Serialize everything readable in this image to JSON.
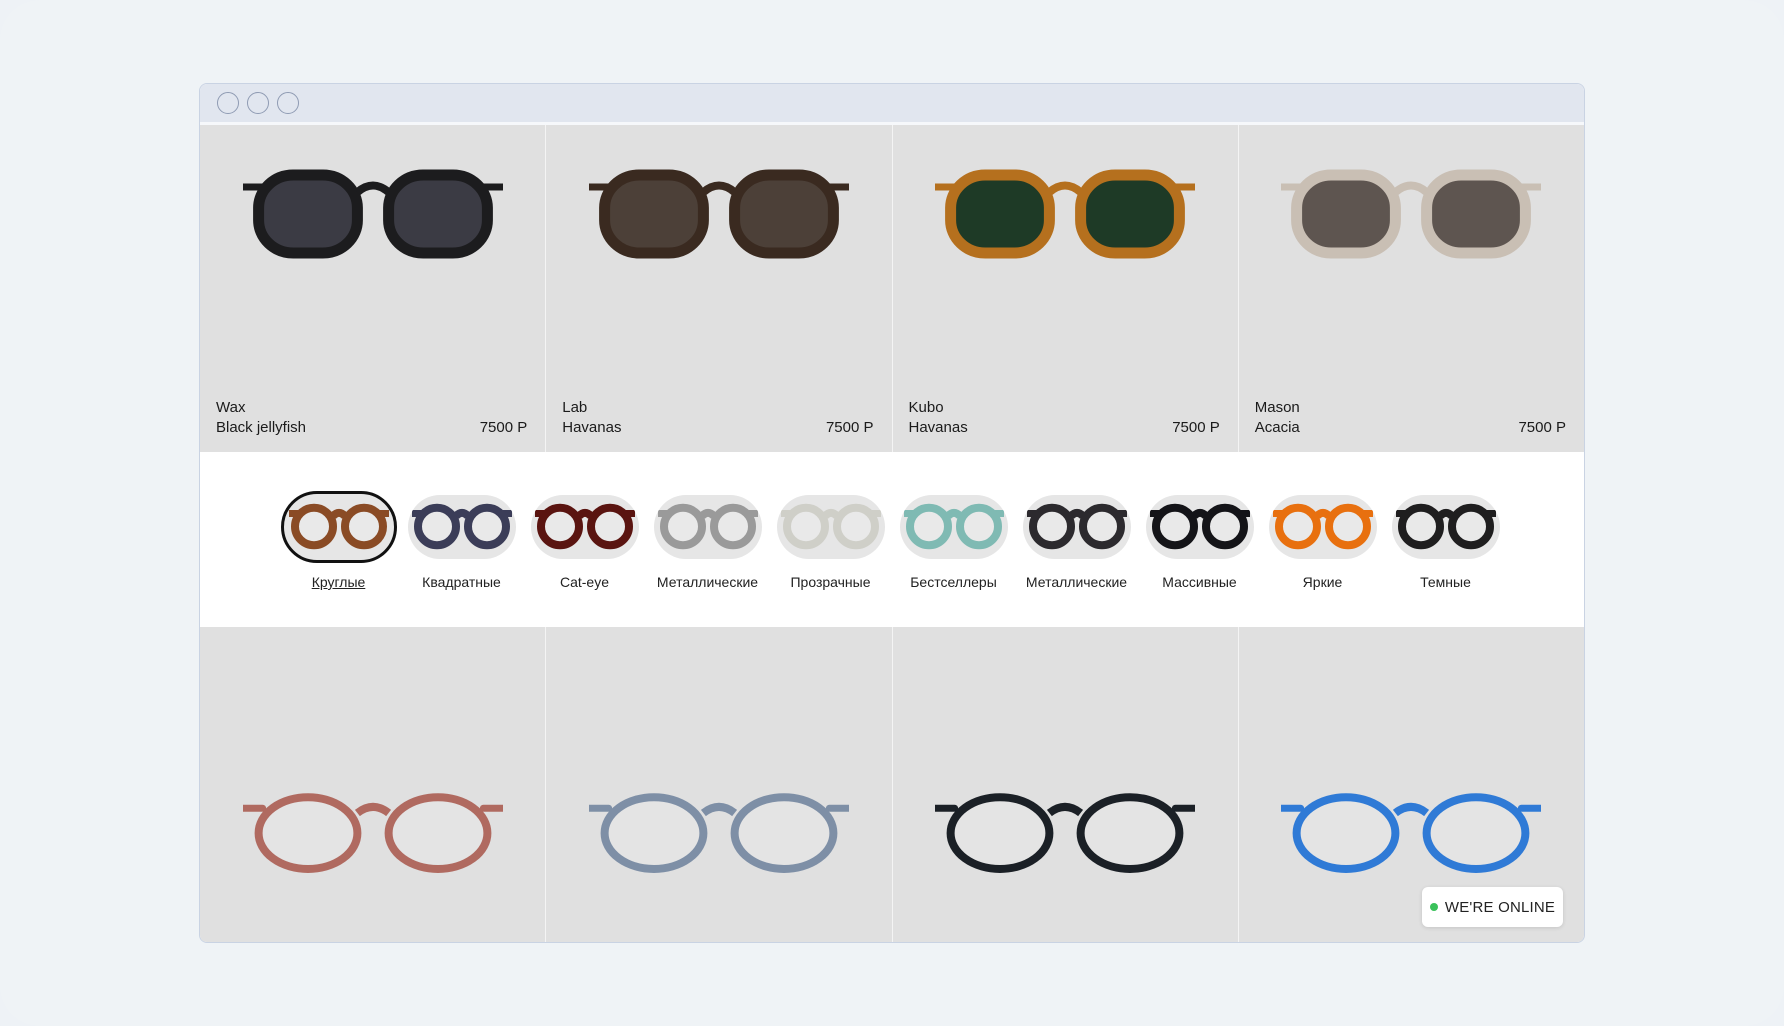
{
  "window": {
    "controls": [
      "window-dot",
      "window-dot",
      "window-dot"
    ]
  },
  "top_products": [
    {
      "model": "Wax",
      "color": "Black jellyfish",
      "price": "7500 Р",
      "frame": "#1c1c1e",
      "lens": "#3b3b44"
    },
    {
      "model": "Lab",
      "color": "Havanas",
      "price": "7500 Р",
      "frame": "#3a2a20",
      "lens": "#4c4038"
    },
    {
      "model": "Kubo",
      "color": "Havanas",
      "price": "7500 Р",
      "frame": "#b5701e",
      "lens": "#1e3a26"
    },
    {
      "model": "Mason",
      "color": "Acacia",
      "price": "7500 Р",
      "frame": "#c9bfb4",
      "lens": "#5e5550"
    }
  ],
  "categories": [
    {
      "label": "Круглые",
      "active": true,
      "frame": "#8a4b25"
    },
    {
      "label": "Квадратные",
      "active": false,
      "frame": "#3b3d58"
    },
    {
      "label": "Cat-eye",
      "active": false,
      "frame": "#5a1410"
    },
    {
      "label": "Металлические",
      "active": false,
      "frame": "#9a9a9a"
    },
    {
      "label": "Прозрачные",
      "active": false,
      "frame": "#cfcfc8"
    },
    {
      "label": "Бестселлеры",
      "active": false,
      "frame": "#7fbab3"
    },
    {
      "label": "Металлические",
      "active": false,
      "frame": "#2c2a2e"
    },
    {
      "label": "Массивные",
      "active": false,
      "frame": "#141418"
    },
    {
      "label": "Яркие",
      "active": false,
      "frame": "#e8700f"
    },
    {
      "label": "Темные",
      "active": false,
      "frame": "#1f1e1f"
    }
  ],
  "bottom_products": [
    {
      "frame": "#b06a60"
    },
    {
      "frame": "#7e8fa6"
    },
    {
      "frame": "#1b2026"
    },
    {
      "frame": "#2f7ad6"
    }
  ],
  "chat": {
    "label": "WE'RE ONLINE",
    "status_color": "#3ac15a"
  }
}
